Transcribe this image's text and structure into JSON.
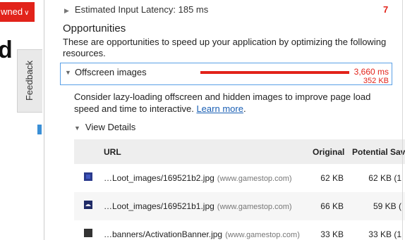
{
  "site": {
    "owned_badge": "wned",
    "big_letter": "d",
    "feedback_label": "Feedback"
  },
  "audit": {
    "latency_label": "Estimated Input Latency: 185 ms",
    "latency_score": "7",
    "opportunities_title": "Opportunities",
    "opportunities_desc": "These are opportunities to speed up your application by optimizing the following resources.",
    "offscreen": {
      "label": "Offscreen images",
      "time": "3,660 ms",
      "size": "352 KB",
      "bar_color": "#e2231a"
    },
    "help_text": "Consider lazy-loading offscreen and hidden images to improve page load speed and time to interactive.",
    "learn_more": "Learn more",
    "help_suffix": ".",
    "view_details": "View Details",
    "table": {
      "headers": {
        "url": "URL",
        "original": "Original",
        "savings": "Potential Sav"
      },
      "rows": [
        {
          "url": "…Loot_images/169521b2.jpg",
          "domain": "(www.gamestop.com)",
          "original": "62 KB",
          "savings": "62 KB (1"
        },
        {
          "url": "…Loot_images/169521b1.jpg",
          "domain": "(www.gamestop.com)",
          "original": "66 KB",
          "savings": "59 KB ("
        },
        {
          "url": "…banners/ActivationBanner.jpg",
          "domain": "(www.gamestop.com)",
          "original": "33 KB",
          "savings": "33 KB (1"
        }
      ]
    }
  },
  "colors": {
    "accent_red": "#e2231a",
    "link_blue": "#1a5fb4",
    "focus_blue": "#5aa0e6"
  }
}
